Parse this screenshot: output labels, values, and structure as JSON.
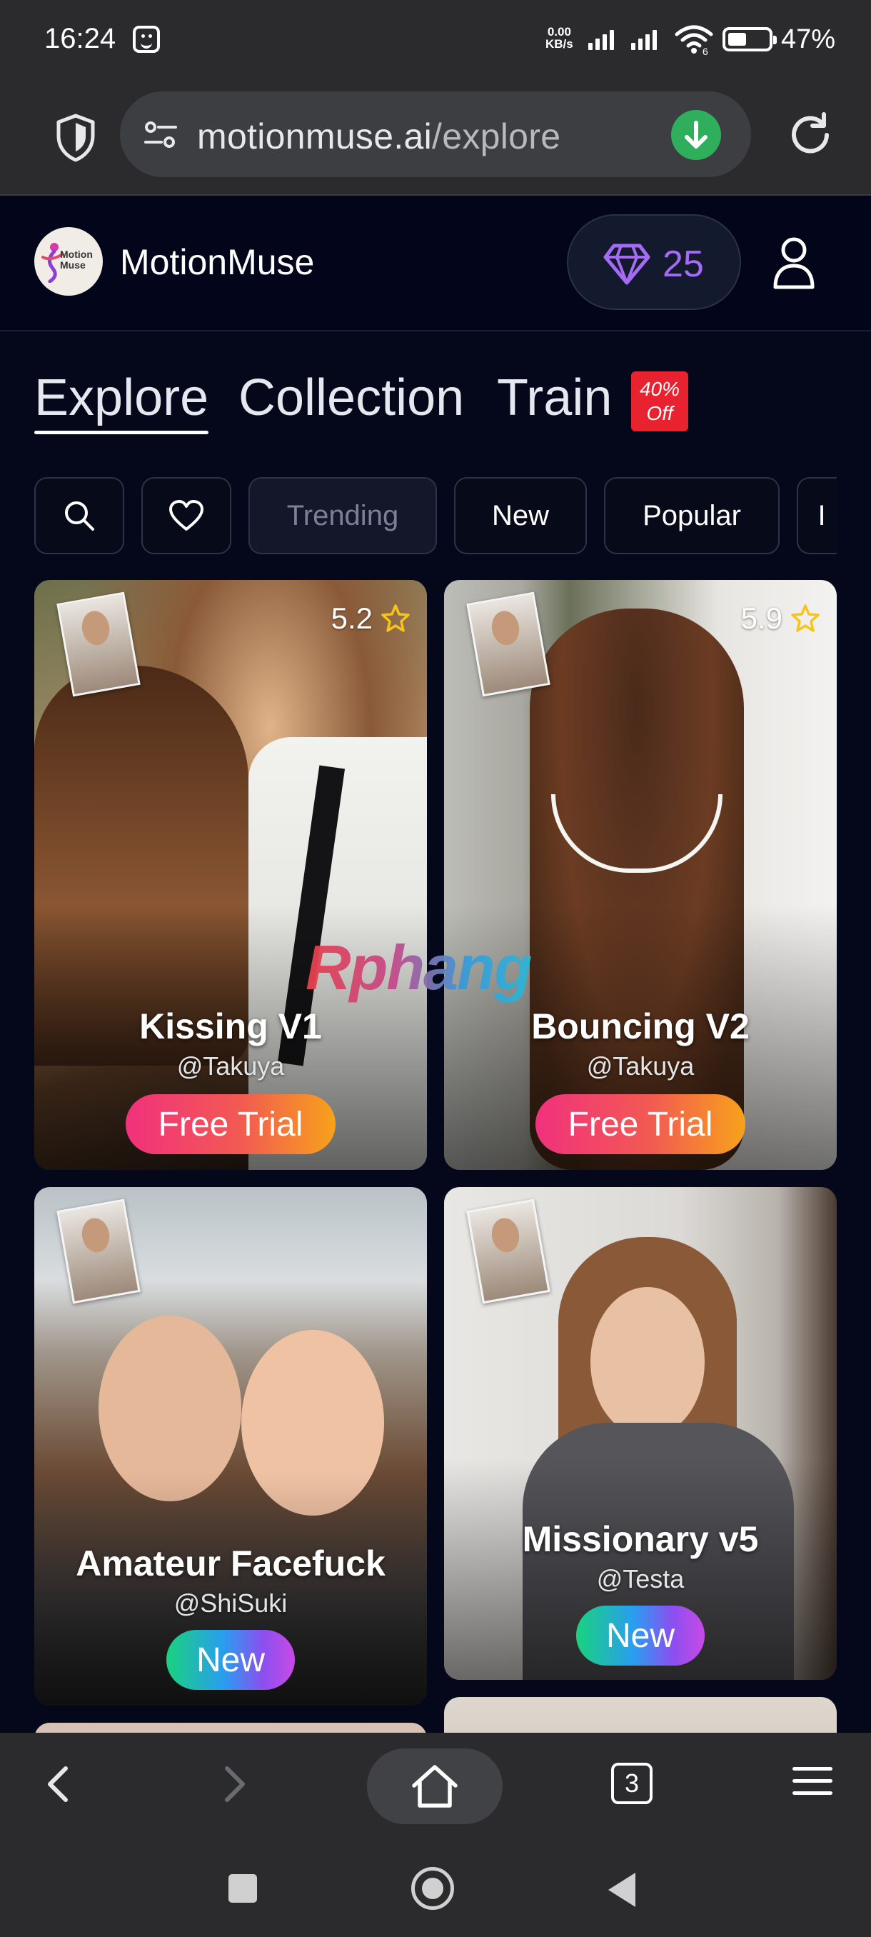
{
  "status_bar": {
    "time": "16:24",
    "net_speed_value": "0.00",
    "net_speed_unit": "KB/s",
    "wifi_badge": "6",
    "battery_level": 0.47,
    "battery_text": "47%",
    "icons": [
      "app-notification-icon",
      "signal-icon",
      "wifi-icon",
      "battery-icon"
    ]
  },
  "browser": {
    "url_host": "motionmuse.ai",
    "url_path": "/explore",
    "tab_count": "3",
    "icons": [
      "shield-icon",
      "tune-icon",
      "download-icon",
      "reload-icon",
      "back-icon",
      "forward-icon",
      "home-icon",
      "menu-icon"
    ],
    "download_color": "#2fae5c"
  },
  "site": {
    "logo_line1": "Motion",
    "logo_line2": "Muse",
    "brand": "MotionMuse",
    "gems": "25",
    "gem_color": "#a66bf5"
  },
  "tabs": [
    {
      "label": "Explore",
      "active": true
    },
    {
      "label": "Collection",
      "active": false
    },
    {
      "label": "Train",
      "active": false
    }
  ],
  "sale_badge": {
    "line1": "40%",
    "line2": "Off",
    "color": "#e8222f"
  },
  "filters": {
    "trending": "Trending",
    "new": "New",
    "popular": "Popular",
    "more": "I"
  },
  "cards": [
    {
      "title": "Kissing V1",
      "author": "@Takuya",
      "rating": "5.2",
      "button": "Free Trial"
    },
    {
      "title": "Bouncing V2",
      "author": "@Takuya",
      "rating": "5.9",
      "button": "Free Trial"
    },
    {
      "title": "Amateur Facefuck",
      "author": "@ShiSuki",
      "button": "New"
    },
    {
      "title": "Missionary v5",
      "author": "@Testa",
      "button": "New"
    }
  ],
  "watermark": "Rphang"
}
